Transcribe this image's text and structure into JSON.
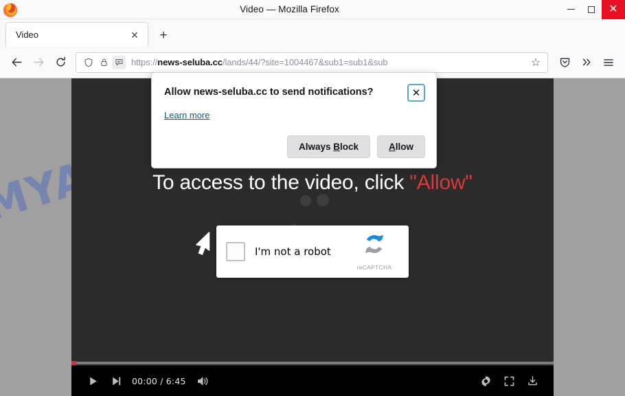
{
  "window": {
    "title": "Video — Mozilla Firefox",
    "minimize_label": "Minimize",
    "maximize_label": "Maximize",
    "close_label": "Close"
  },
  "tabs": {
    "items": [
      {
        "label": "Video",
        "close_glyph": "✕"
      }
    ],
    "new_tab_glyph": "+"
  },
  "toolbar": {
    "back_glyph": "←",
    "forward_glyph": "→",
    "reload_glyph": "⟳",
    "url": {
      "scheme": "https://",
      "host": "news-seluba.cc",
      "path": "/lands/44/?site=1004467&sub1=sub1&sub",
      "full": "https://news-seluba.cc/lands/44/?site=1004467&sub1=sub1&sub"
    },
    "bookmark_glyph": "☆",
    "pocket_label": "Save to Pocket",
    "overflow_glyph": "»",
    "menu_label": "Open application menu"
  },
  "notification": {
    "title": "Allow news-seluba.cc to send notifications?",
    "close_glyph": "✕",
    "learn_more": "Learn more",
    "block_button": {
      "pre": "Always ",
      "key": "B",
      "post": "lock"
    },
    "allow_button": {
      "pre": "",
      "key": "A",
      "post": "llow"
    }
  },
  "page": {
    "watermark": "MYANTISPYWARE.COM",
    "cta_plain": "To access to the video, click ",
    "cta_highlight": "\"Allow\"",
    "cta_highlight_color": "#d83a3a",
    "background_color": "#a0a0a0",
    "video_background_color": "#2b2b2b"
  },
  "captcha": {
    "checkbox_label": "I'm not a robot",
    "brand_label": "reCAPTCHA",
    "checked": false
  },
  "player": {
    "play_label": "Play",
    "next_label": "Next",
    "current_time": "00:00",
    "separator": " / ",
    "duration": "6:45",
    "timecode": "00:00 / 6:45",
    "volume_label": "Mute",
    "settings_label": "Settings",
    "fullscreen_label": "Full screen",
    "download_label": "Download",
    "progress_percent": 1,
    "progress_color": "#c0394b"
  }
}
